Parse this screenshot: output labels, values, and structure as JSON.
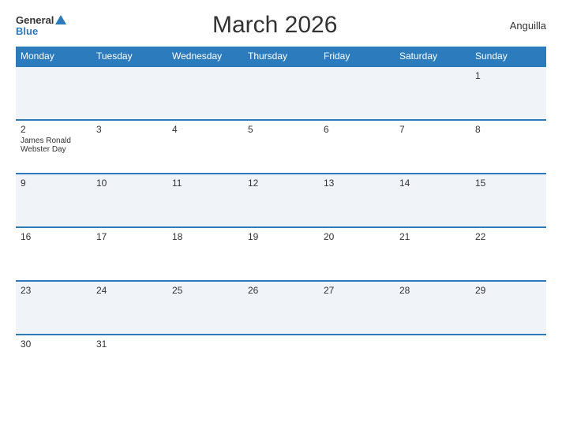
{
  "header": {
    "title": "March 2026",
    "region": "Anguilla",
    "logo": {
      "general": "General",
      "blue": "Blue"
    }
  },
  "weekdays": [
    "Monday",
    "Tuesday",
    "Wednesday",
    "Thursday",
    "Friday",
    "Saturday",
    "Sunday"
  ],
  "weeks": [
    [
      {
        "day": "",
        "event": ""
      },
      {
        "day": "",
        "event": ""
      },
      {
        "day": "",
        "event": ""
      },
      {
        "day": "",
        "event": ""
      },
      {
        "day": "",
        "event": ""
      },
      {
        "day": "",
        "event": ""
      },
      {
        "day": "1",
        "event": ""
      }
    ],
    [
      {
        "day": "2",
        "event": "James Ronald Webster Day"
      },
      {
        "day": "3",
        "event": ""
      },
      {
        "day": "4",
        "event": ""
      },
      {
        "day": "5",
        "event": ""
      },
      {
        "day": "6",
        "event": ""
      },
      {
        "day": "7",
        "event": ""
      },
      {
        "day": "8",
        "event": ""
      }
    ],
    [
      {
        "day": "9",
        "event": ""
      },
      {
        "day": "10",
        "event": ""
      },
      {
        "day": "11",
        "event": ""
      },
      {
        "day": "12",
        "event": ""
      },
      {
        "day": "13",
        "event": ""
      },
      {
        "day": "14",
        "event": ""
      },
      {
        "day": "15",
        "event": ""
      }
    ],
    [
      {
        "day": "16",
        "event": ""
      },
      {
        "day": "17",
        "event": ""
      },
      {
        "day": "18",
        "event": ""
      },
      {
        "day": "19",
        "event": ""
      },
      {
        "day": "20",
        "event": ""
      },
      {
        "day": "21",
        "event": ""
      },
      {
        "day": "22",
        "event": ""
      }
    ],
    [
      {
        "day": "23",
        "event": ""
      },
      {
        "day": "24",
        "event": ""
      },
      {
        "day": "25",
        "event": ""
      },
      {
        "day": "26",
        "event": ""
      },
      {
        "day": "27",
        "event": ""
      },
      {
        "day": "28",
        "event": ""
      },
      {
        "day": "29",
        "event": ""
      }
    ],
    [
      {
        "day": "30",
        "event": ""
      },
      {
        "day": "31",
        "event": ""
      },
      {
        "day": "",
        "event": ""
      },
      {
        "day": "",
        "event": ""
      },
      {
        "day": "",
        "event": ""
      },
      {
        "day": "",
        "event": ""
      },
      {
        "day": "",
        "event": ""
      }
    ]
  ]
}
